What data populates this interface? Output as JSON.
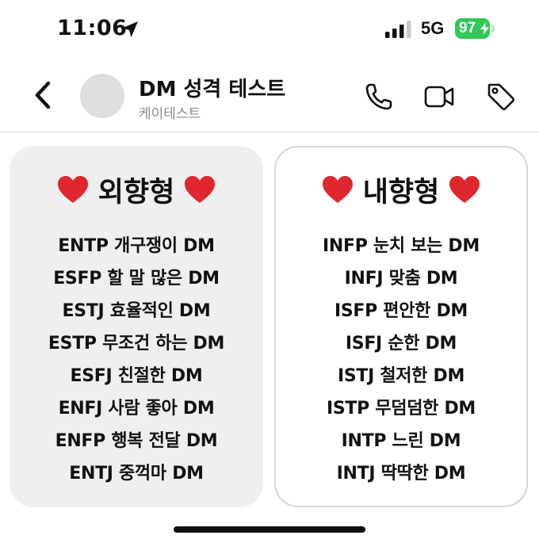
{
  "status_bar": {
    "time": "11:06",
    "network": "5G",
    "battery_level": "97",
    "icons": [
      "location-arrow-icon",
      "signal-bars-icon",
      "battery-charging-icon"
    ]
  },
  "header": {
    "title": "DM 성격 테스트",
    "subtitle": "케이테스트",
    "icons": [
      "chevron-left-icon",
      "phone-icon",
      "video-camera-icon",
      "tag-icon"
    ]
  },
  "cards": [
    {
      "heading": "외향형",
      "heading_icon": "red-heart-icon",
      "items": [
        "ENTP 개구쟁이 DM",
        "ESFP 할 말 많은 DM",
        "ESTJ 효율적인 DM",
        "ESTP 무조건 하는 DM",
        "ESFJ 친절한 DM",
        "ENFJ 사람 좋아 DM",
        "ENFP 행복 전달 DM",
        "ENTJ 중꺽마 DM"
      ]
    },
    {
      "heading": "내향형",
      "heading_icon": "red-heart-icon",
      "items": [
        "INFP 눈치 보는 DM",
        "INFJ 맞춤 DM",
        "ISFP 편안한 DM",
        "ISFJ 순한 DM",
        "ISTJ 철저한 DM",
        "ISTP 무덤덤한 DM",
        "INTP 느린 DM",
        "INTJ 딱딱한 DM"
      ]
    }
  ],
  "colors": {
    "battery_green": "#33c759",
    "heart_red": "#e0262e",
    "left_card_bg": "#efefef",
    "right_card_border": "#d6d6d6",
    "subtitle_gray": "#8a8a8a",
    "avatar_gray": "#dedede"
  }
}
